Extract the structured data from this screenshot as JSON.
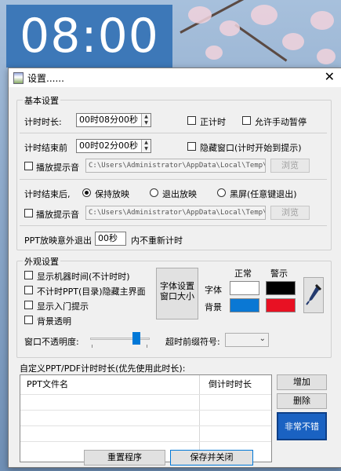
{
  "timer_display": "08:00",
  "dialog": {
    "title": "设置......",
    "close_glyph": "✕"
  },
  "basic": {
    "legend": "基本设置",
    "duration_label": "计时时长:",
    "duration_value": "00时08分00秒",
    "countup_label": "正计时",
    "countup_checked": false,
    "manual_pause_label": "允许手动暂停",
    "manual_pause_checked": false,
    "before_end_label": "计时结束前",
    "before_end_value": "00时02分00秒",
    "hide_window_label": "隐藏窗口(计时开始到提示)",
    "hide_window_checked": false,
    "play_sound_label": "播放提示音",
    "play_sound_checked": false,
    "sound_path_1": "C:\\Users\\Administrator\\AppData\\Local\\Temp\\",
    "browse_label": "浏览",
    "after_end_label": "计时结束后,",
    "after_end_options": [
      "保持放映",
      "退出放映",
      "黑屏(任意键退出)"
    ],
    "after_end_selected": 0,
    "play_sound_label_2": "播放提示音",
    "play_sound_checked_2": false,
    "sound_path_2": "C:\\Users\\Administrator\\AppData\\Local\\Temp\\",
    "browse_label_2": "浏览",
    "ppt_exit_prefix": "PPT放映意外退出",
    "ppt_exit_value": "00秒",
    "ppt_exit_suffix": "内不重新计时"
  },
  "appearance": {
    "legend": "外观设置",
    "options": [
      {
        "label": "显示机器时间(不计时时)",
        "checked": false
      },
      {
        "label": "不计时PPT(目录)隐藏主界面",
        "checked": false
      },
      {
        "label": "显示入门提示",
        "checked": false
      },
      {
        "label": "背景透明",
        "checked": false
      }
    ],
    "font_button_line1": "字体设置",
    "font_button_line2": "窗口大小",
    "col_normal": "正常",
    "col_warning": "警示",
    "row_font": "字体",
    "row_background": "背景",
    "colors": {
      "font_normal": "#ffffff",
      "font_warning": "#000000",
      "bg_normal": "#0a78d4",
      "bg_warning": "#e81123"
    },
    "opacity_label": "窗口不透明度:",
    "opacity_value": 0.9,
    "prefix_label": "超时前缀符号:",
    "prefix_value": ""
  },
  "custom": {
    "label": "自定义PPT/PDF计时时长(优先使用此时长):",
    "col_file": "PPT文件名",
    "col_countdown": "倒计时时长",
    "rows": [],
    "add_label": "增加",
    "delete_label": "删除",
    "great_label": "非常不错"
  },
  "footer": {
    "reset_label": "重置程序",
    "save_label": "保存并关闭"
  }
}
